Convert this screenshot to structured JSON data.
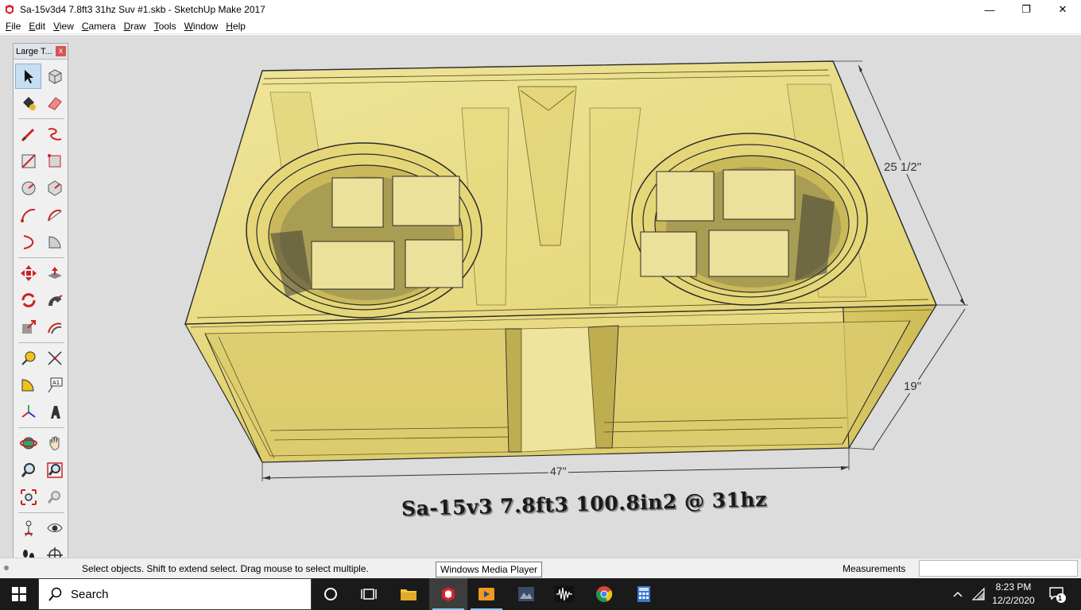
{
  "window": {
    "title": "Sa-15v3d4 7.8ft3 31hz Suv #1.skb - SketchUp Make 2017",
    "minimize": "—",
    "maximize": "❐",
    "close": "✕"
  },
  "menu": [
    {
      "label": "File",
      "key": "F",
      "rest": "ile"
    },
    {
      "label": "Edit",
      "key": "E",
      "rest": "dit"
    },
    {
      "label": "View",
      "key": "V",
      "rest": "iew"
    },
    {
      "label": "Camera",
      "key": "C",
      "rest": "amera"
    },
    {
      "label": "Draw",
      "key": "D",
      "rest": "raw"
    },
    {
      "label": "Tools",
      "key": "T",
      "rest": "ools"
    },
    {
      "label": "Window",
      "key": "W",
      "rest": "indow"
    },
    {
      "label": "Help",
      "key": "H",
      "rest": "elp"
    }
  ],
  "toolbar": {
    "title": "Large T...",
    "close": "x",
    "tools": [
      "select-tool",
      "make-component-tool",
      "paint-bucket-tool",
      "eraser-tool",
      "line-tool",
      "freehand-tool",
      "rectangle-tool",
      "rotated-rectangle-tool",
      "circle-tool",
      "polygon-tool",
      "arc-tool",
      "two-point-arc-tool",
      "three-point-arc-tool",
      "pie-tool",
      "move-tool",
      "push-pull-tool",
      "rotate-tool",
      "follow-me-tool",
      "scale-tool",
      "offset-tool",
      "tape-measure-tool",
      "dimension-tool",
      "protractor-tool",
      "text-tool",
      "axes-tool",
      "3d-text-tool",
      "orbit-tool",
      "pan-tool",
      "zoom-tool",
      "zoom-window-tool",
      "zoom-extents-tool",
      "previous-view-tool",
      "position-camera-tool",
      "look-around-tool",
      "walk-tool",
      "section-plane-tool"
    ]
  },
  "model": {
    "dim_height": "25 1/2\"",
    "dim_depth": "19\"",
    "dim_width": "47\"",
    "label": "Sa-15v3 7.8ft3 100.8in2 @ 31hz"
  },
  "status": {
    "hint": "Select objects. Shift to extend select. Drag mouse to select multiple.",
    "tooltip": "Windows Media Player",
    "measurements_label": "Measurements",
    "measurements_value": ""
  },
  "taskbar": {
    "search_placeholder": "Search",
    "time": "8:23 PM",
    "date": "12/2/2020",
    "notification_count": "1"
  },
  "colors": {
    "wood": "#e7d97a",
    "wood_dark": "#c9b94e",
    "edge": "#2a2a2a",
    "workspace": "#dcdcdc"
  }
}
